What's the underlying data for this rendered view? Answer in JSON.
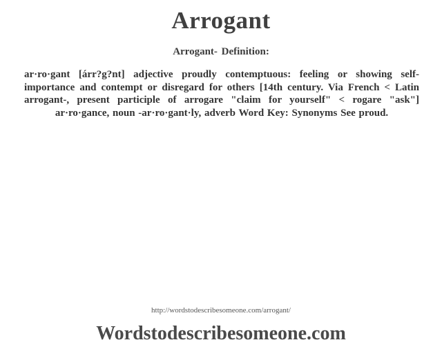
{
  "header": {
    "title": "Arrogant",
    "subtitle": "Arrogant- Definition:"
  },
  "definition": {
    "text": "ar·ro·gant [árr?g?nt] adjective proudly contemptuous: feeling or showing self-importance and contempt or disregard for others [14th century. Via French < Latin arrogant-, present participle of arrogare \"claim for yourself\" < rogare \"ask\"] ar·ro·gance, noun -ar·ro·gant·ly, adverb Word Key: Synonyms See proud."
  },
  "footer": {
    "url": "http://wordstodescribesomeone.com/arrogant/",
    "site_name": "Wordstodescribesomeone.com"
  }
}
